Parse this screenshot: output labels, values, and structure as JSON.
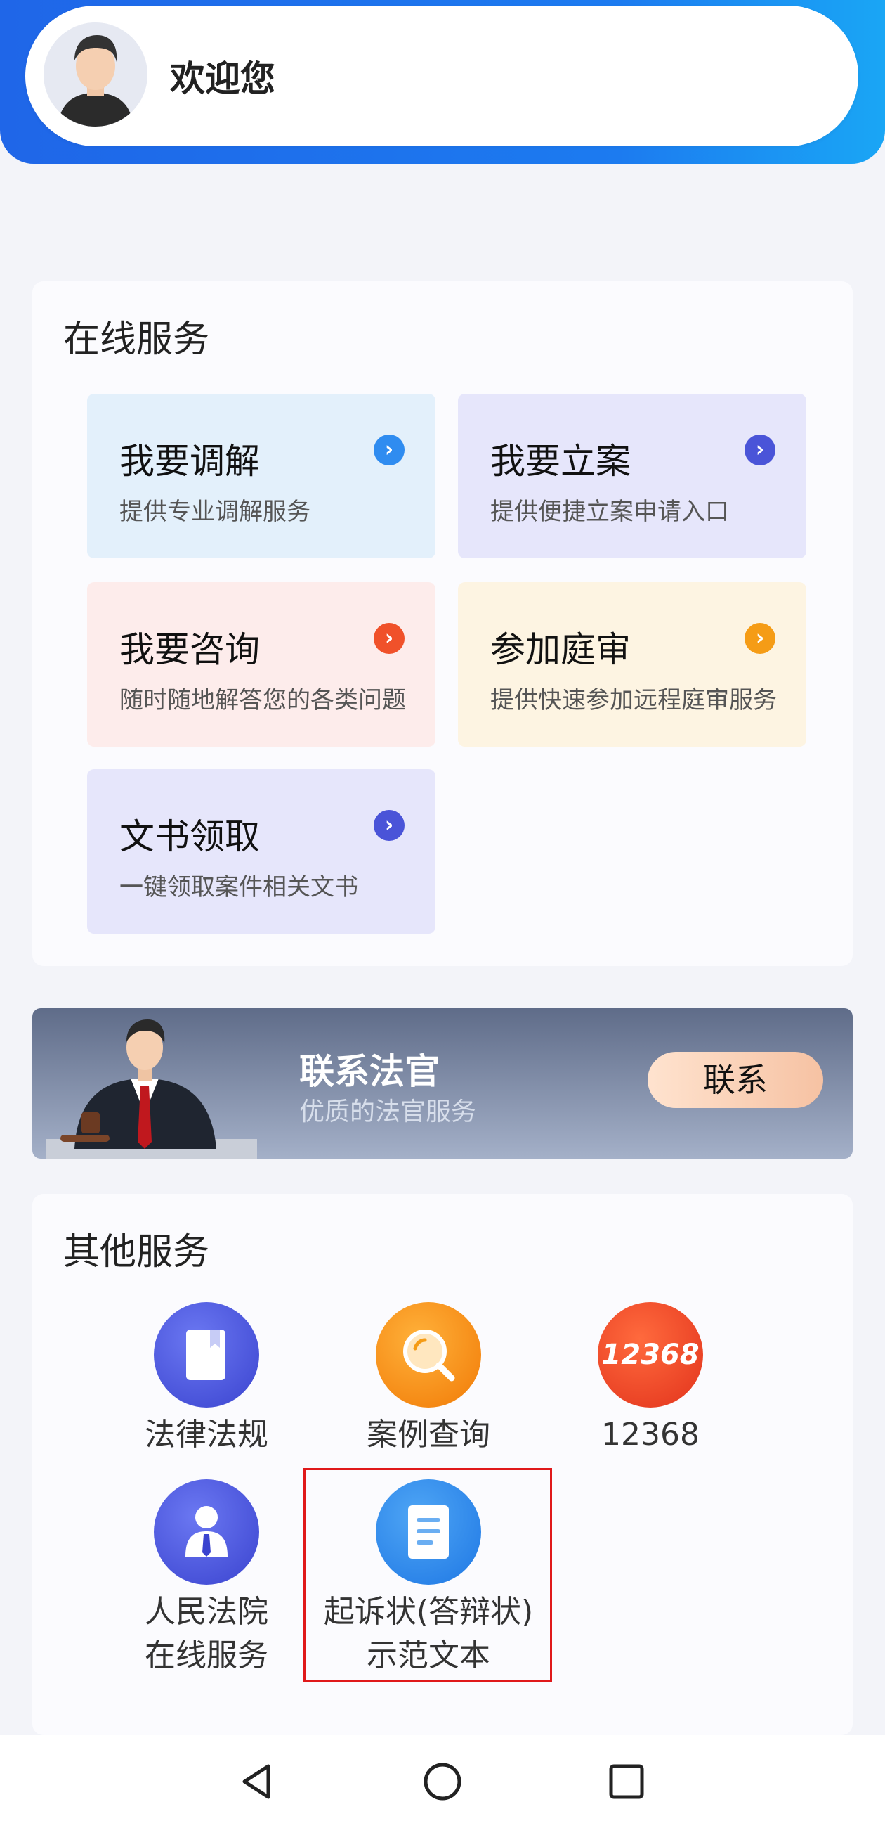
{
  "header": {
    "welcome": "欢迎您"
  },
  "online_services": {
    "title": "在线服务",
    "items": [
      {
        "title": "我要调解",
        "desc": "提供专业调解服务",
        "color": "#2F8CF0"
      },
      {
        "title": "我要立案",
        "desc": "提供便捷立案申请入口",
        "color": "#4A54D8"
      },
      {
        "title": "我要咨询",
        "desc": "随时随地解答您的各类问题",
        "color": "#F0512A"
      },
      {
        "title": "参加庭审",
        "desc": "提供快速参加远程庭审服务",
        "color": "#F59C16"
      },
      {
        "title": "文书领取",
        "desc": "一键领取案件相关文书",
        "color": "#4A54D8"
      }
    ]
  },
  "banner": {
    "title": "联系法官",
    "subtitle": "优质的法官服务",
    "button": "联系"
  },
  "other_services": {
    "title": "其他服务",
    "items": [
      {
        "label": "法律法规",
        "icon": "book-icon"
      },
      {
        "label": "案例查询",
        "icon": "search-icon"
      },
      {
        "label": "12368",
        "icon": "hotline-12368-icon",
        "icon_text": "12368"
      },
      {
        "label_line1": "人民法院",
        "label_line2": "在线服务",
        "icon": "person-icon"
      },
      {
        "label_line1": "起诉状(答辩状)",
        "label_line2": "示范文本",
        "icon": "document-icon"
      }
    ]
  },
  "navbar": {
    "back": "back-icon",
    "home": "home-icon",
    "recent": "recent-apps-icon"
  }
}
